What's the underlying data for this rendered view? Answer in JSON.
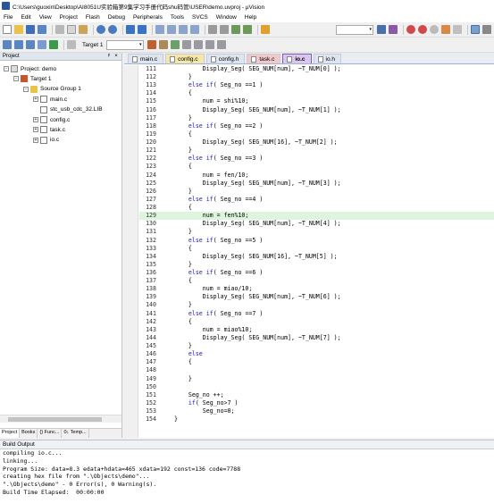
{
  "window": {
    "title": "C:\\Users\\guoxin\\Desktop\\AI8051U实验箱第9集学习手册代码shu码管\\USER\\demo.uvproj - µVision"
  },
  "menu": [
    "File",
    "Edit",
    "View",
    "Project",
    "Flash",
    "Debug",
    "Peripherals",
    "Tools",
    "SVCS",
    "Window",
    "Help"
  ],
  "toolbar": {
    "target_label": "Target 1"
  },
  "project_panel": {
    "title": "Project",
    "tree": [
      {
        "label": "Project: demo",
        "level": 0,
        "expander": "-",
        "icon": "project-icon"
      },
      {
        "label": "Target 1",
        "level": 1,
        "expander": "-",
        "icon": "target-icon"
      },
      {
        "label": "Source Group 1",
        "level": 2,
        "expander": "-",
        "icon": "folder-icon"
      },
      {
        "label": "main.c",
        "level": 3,
        "expander": "+",
        "icon": "file-icon"
      },
      {
        "label": "stc_usb_cdc_32.LIB",
        "level": 3,
        "expander": "",
        "icon": "file-icon"
      },
      {
        "label": "config.c",
        "level": 3,
        "expander": "+",
        "icon": "file-icon"
      },
      {
        "label": "task.c",
        "level": 3,
        "expander": "+",
        "icon": "file-icon"
      },
      {
        "label": "io.c",
        "level": 3,
        "expander": "+",
        "icon": "file-icon"
      }
    ],
    "bottom_tabs": [
      "Project",
      "Books",
      "{} Func...",
      "0↓ Temp..."
    ]
  },
  "editor": {
    "tabs": [
      {
        "label": "main.c",
        "color": "#dfe5ef"
      },
      {
        "label": "config.c",
        "color": "#f6e7a6"
      },
      {
        "label": "config.h",
        "color": "#dfe5ef"
      },
      {
        "label": "task.c",
        "color": "#f3c8c8"
      },
      {
        "label": "io.c",
        "color": "#d9c7ee"
      },
      {
        "label": "io.h",
        "color": "#dfe5ef"
      }
    ],
    "highlighted_line": 129,
    "lines": [
      {
        "n": "111",
        "code": "        Display_Seg( SEG_NUM[num], ~T_NUM[0] );"
      },
      {
        "n": "112",
        "code": "    }"
      },
      {
        "n": "113",
        "code": "    else if( Seg_no ==1 )"
      },
      {
        "n": "114",
        "code": "    {"
      },
      {
        "n": "115",
        "code": "        num = shi%10;"
      },
      {
        "n": "116",
        "code": "        Display_Seg( SEG_NUM[num], ~T_NUM[1] );"
      },
      {
        "n": "117",
        "code": "    }"
      },
      {
        "n": "118",
        "code": "    else if( Seg_no ==2 )"
      },
      {
        "n": "119",
        "code": "    {"
      },
      {
        "n": "120",
        "code": "        Display_Seg( SEG_NUM[16], ~T_NUM[2] );"
      },
      {
        "n": "121",
        "code": "    }"
      },
      {
        "n": "122",
        "code": "    else if( Seg_no ==3 )"
      },
      {
        "n": "123",
        "code": "    {"
      },
      {
        "n": "124",
        "code": "        num = fen/10;"
      },
      {
        "n": "125",
        "code": "        Display_Seg( SEG_NUM[num], ~T_NUM[3] );"
      },
      {
        "n": "126",
        "code": "    }"
      },
      {
        "n": "127",
        "code": "    else if( Seg_no ==4 )"
      },
      {
        "n": "128",
        "code": "    {"
      },
      {
        "n": "129",
        "code": "        num = fen%10;"
      },
      {
        "n": "130",
        "code": "        Display_Seg( SEG_NUM[num], ~T_NUM[4] );"
      },
      {
        "n": "131",
        "code": "    }"
      },
      {
        "n": "132",
        "code": "    else if( Seg_no ==5 )"
      },
      {
        "n": "133",
        "code": "    {"
      },
      {
        "n": "134",
        "code": "        Display_Seg( SEG_NUM[16], ~T_NUM[5] );"
      },
      {
        "n": "135",
        "code": "    }"
      },
      {
        "n": "136",
        "code": "    else if( Seg_no ==6 )"
      },
      {
        "n": "137",
        "code": "    {"
      },
      {
        "n": "138",
        "code": "        num = miao/10;"
      },
      {
        "n": "139",
        "code": "        Display_Seg( SEG_NUM[num], ~T_NUM[6] );"
      },
      {
        "n": "140",
        "code": "    }"
      },
      {
        "n": "141",
        "code": "    else if( Seg_no ==7 )"
      },
      {
        "n": "142",
        "code": "    {"
      },
      {
        "n": "143",
        "code": "        num = miao%10;"
      },
      {
        "n": "144",
        "code": "        Display_Seg( SEG_NUM[num], ~T_NUM[7] );"
      },
      {
        "n": "145",
        "code": "    }"
      },
      {
        "n": "146",
        "code": "    else"
      },
      {
        "n": "147",
        "code": "    {"
      },
      {
        "n": "148",
        "code": ""
      },
      {
        "n": "149",
        "code": "    }"
      },
      {
        "n": "150",
        "code": ""
      },
      {
        "n": "151",
        "code": "    Seg_no ++;"
      },
      {
        "n": "152",
        "code": "    if( Seg_no>7 )"
      },
      {
        "n": "153",
        "code": "        Seg_no=0;"
      },
      {
        "n": "154",
        "code": "}"
      }
    ]
  },
  "build_output": {
    "title": "Build Output",
    "lines": [
      "compiling io.c...",
      "linking...",
      "Program Size: data=8.3 edata+hdata=465 xdata=192 const=136 code=7788",
      "creating hex file from \".\\Objects\\demo\"...",
      "\".\\Objects\\demo\" - 0 Error(s), 0 Warning(s).",
      "Build Time Elapsed:  00:00:00"
    ]
  }
}
